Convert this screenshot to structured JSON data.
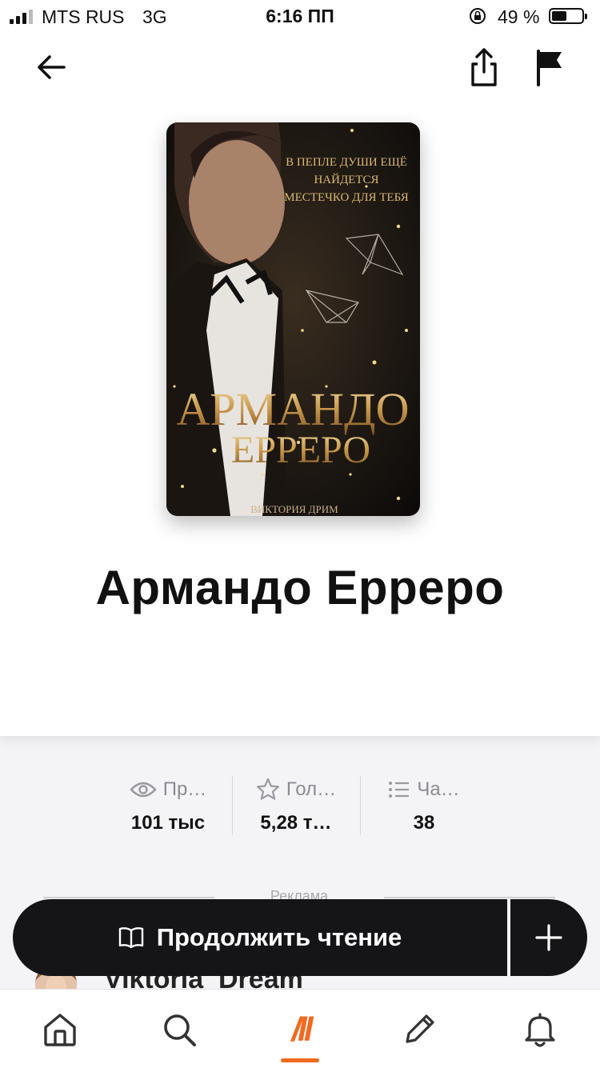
{
  "status_bar": {
    "carrier": "MTS RUS",
    "network": "3G",
    "time": "6:16 ПП",
    "battery": "49 %",
    "battery_level": 0.49
  },
  "book": {
    "title": "Армандо Ерреро",
    "cover": {
      "tagline": [
        "В ПЕПЛЕ ДУШИ ЕЩЁ",
        "НАЙДЕТСЯ",
        "МЕСТЕЧКО ДЛЯ ТЕБЯ"
      ],
      "title_lines": [
        "АРМАНДО",
        "ЕРРЕРО"
      ],
      "author": "ВИКТОРИЯ ДРИМ"
    }
  },
  "stats": [
    {
      "icon": "eye-icon",
      "label": "Пр…",
      "value": "101 тыс"
    },
    {
      "icon": "star-icon",
      "label": "Гол…",
      "value": "5,28 т…"
    },
    {
      "icon": "list-icon",
      "label": "Ча…",
      "value": "38"
    }
  ],
  "ad_label": "Реклама",
  "author_name": "Viktoria_Dream",
  "cta": {
    "label": "Продолжить чтение",
    "icon": "book-open-icon"
  },
  "plus_icon": "plus-icon",
  "tabs": [
    {
      "name": "home",
      "icon": "home-icon"
    },
    {
      "name": "search",
      "icon": "search-icon"
    },
    {
      "name": "logo",
      "icon": "logo-icon",
      "text": "/ll",
      "active": true
    },
    {
      "name": "write",
      "icon": "pencil-icon"
    },
    {
      "name": "notifications",
      "icon": "bell-icon"
    }
  ],
  "colors": {
    "accent": "#f06a20",
    "dark": "#151417",
    "background": "#f4f3f6"
  }
}
